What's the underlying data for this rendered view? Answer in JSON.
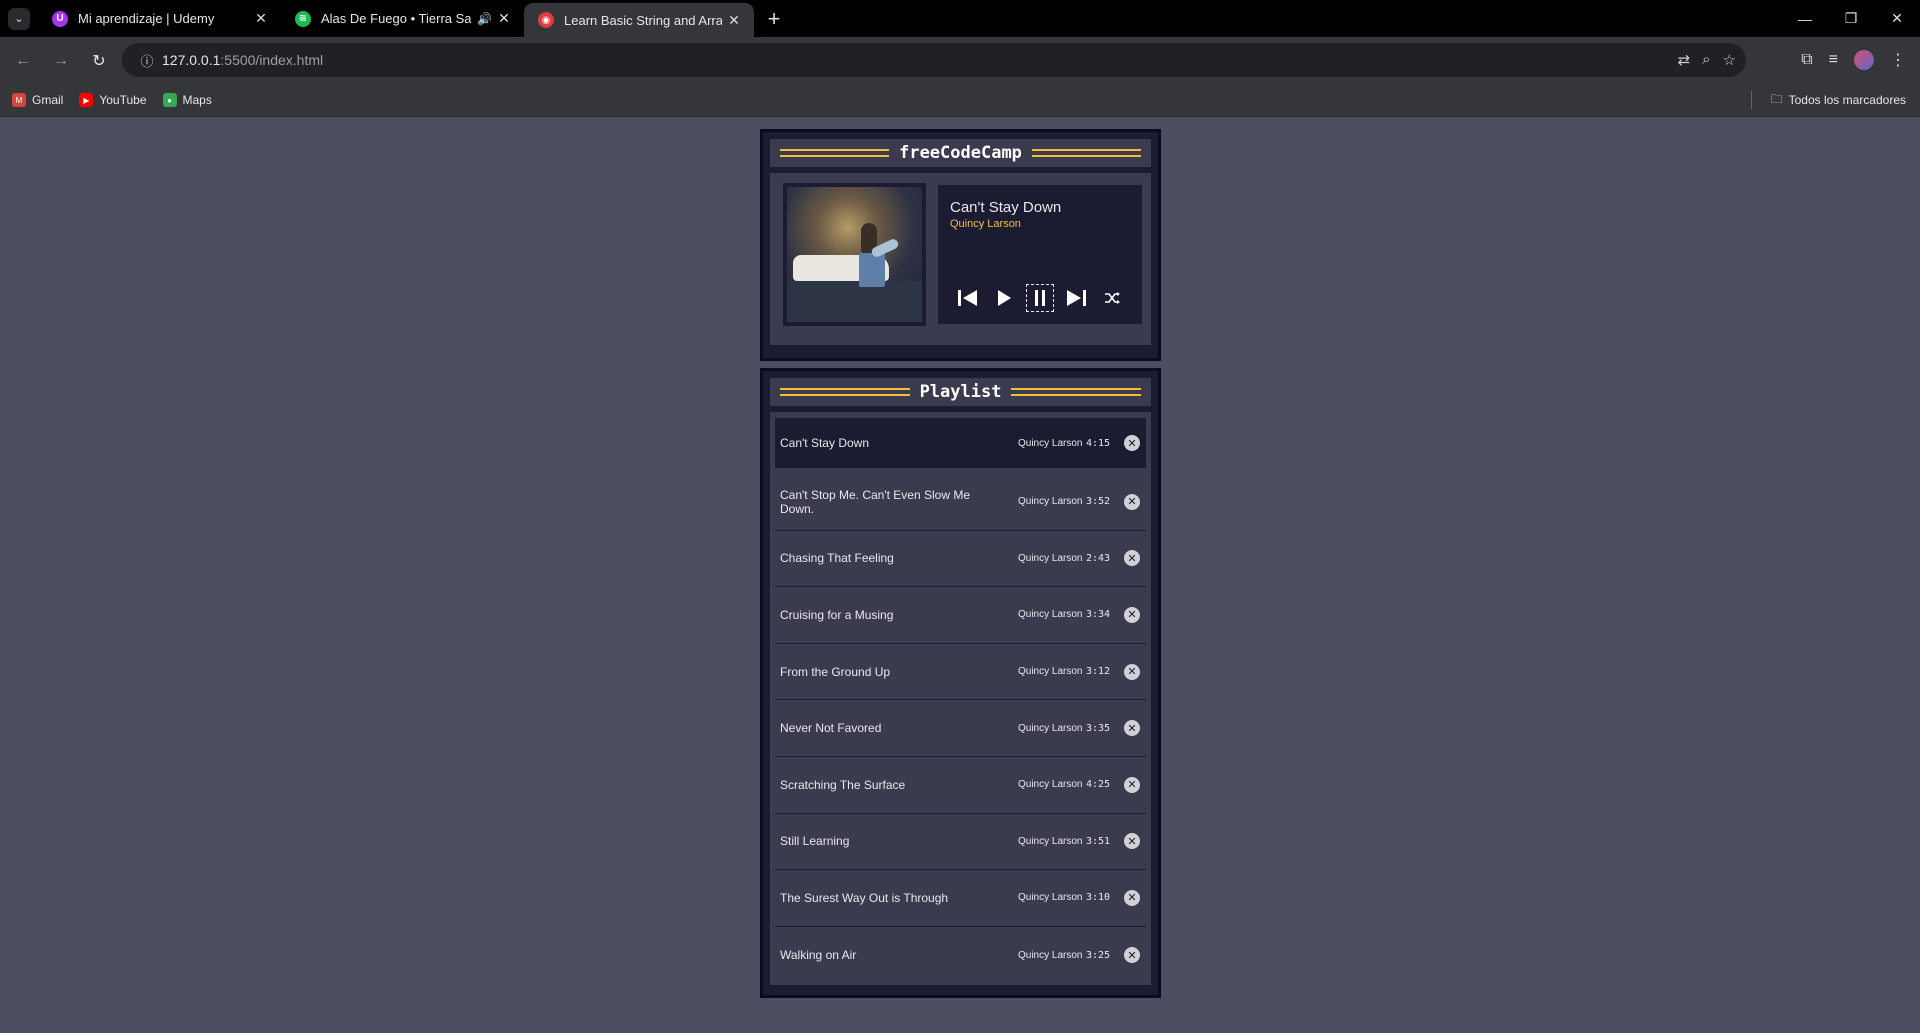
{
  "browser": {
    "tabs": [
      {
        "title": "Mi aprendizaje | Udemy",
        "favicon_color": "#a435f0",
        "favicon_glyph": "U"
      },
      {
        "title": "Alas De Fuego • Tierra Santa",
        "favicon_color": "#1db954",
        "favicon_glyph": "≋",
        "audio": "🔊"
      },
      {
        "title": "Learn Basic String and Array Methods",
        "favicon_color": "#e23a3a",
        "favicon_glyph": "◉"
      }
    ],
    "url_host": "127.0.0.1",
    "url_path": ":5500/index.html",
    "bookmarks": [
      {
        "label": "Gmail",
        "color": "#d44638",
        "glyph": "M"
      },
      {
        "label": "YouTube",
        "color": "#ff0000",
        "glyph": "▶"
      },
      {
        "label": "Maps",
        "color": "#34a853",
        "glyph": "●"
      }
    ],
    "all_bookmarks": "Todos los marcadores"
  },
  "player": {
    "header": "freeCodeCamp",
    "song_title": "Can't Stay Down",
    "song_artist": "Quincy Larson",
    "controls": [
      "previous-icon",
      "play-icon",
      "pause-icon",
      "next-icon",
      "shuffle-icon"
    ]
  },
  "playlist": {
    "header": "Playlist",
    "songs": [
      {
        "title": "Can't Stay Down",
        "artist": "Quincy Larson",
        "duration": "4:15"
      },
      {
        "title": "Can't Stop Me. Can't Even Slow Me Down.",
        "artist": "Quincy Larson",
        "duration": "3:52"
      },
      {
        "title": "Chasing That Feeling",
        "artist": "Quincy Larson",
        "duration": "2:43"
      },
      {
        "title": "Cruising for a Musing",
        "artist": "Quincy Larson",
        "duration": "3:34"
      },
      {
        "title": "From the Ground Up",
        "artist": "Quincy Larson",
        "duration": "3:12"
      },
      {
        "title": "Never Not Favored",
        "artist": "Quincy Larson",
        "duration": "3:35"
      },
      {
        "title": "Scratching The Surface",
        "artist": "Quincy Larson",
        "duration": "4:25"
      },
      {
        "title": "Still Learning",
        "artist": "Quincy Larson",
        "duration": "3:51"
      },
      {
        "title": "The Surest Way Out is Through",
        "artist": "Quincy Larson",
        "duration": "3:10"
      },
      {
        "title": "Walking on Air",
        "artist": "Quincy Larson",
        "duration": "3:25"
      }
    ]
  },
  "colors": {
    "page_bg": "#4d4d62",
    "panel_dark": "#1b1b32",
    "panel_mid": "#3b3b4f",
    "accent": "#f1be32"
  }
}
